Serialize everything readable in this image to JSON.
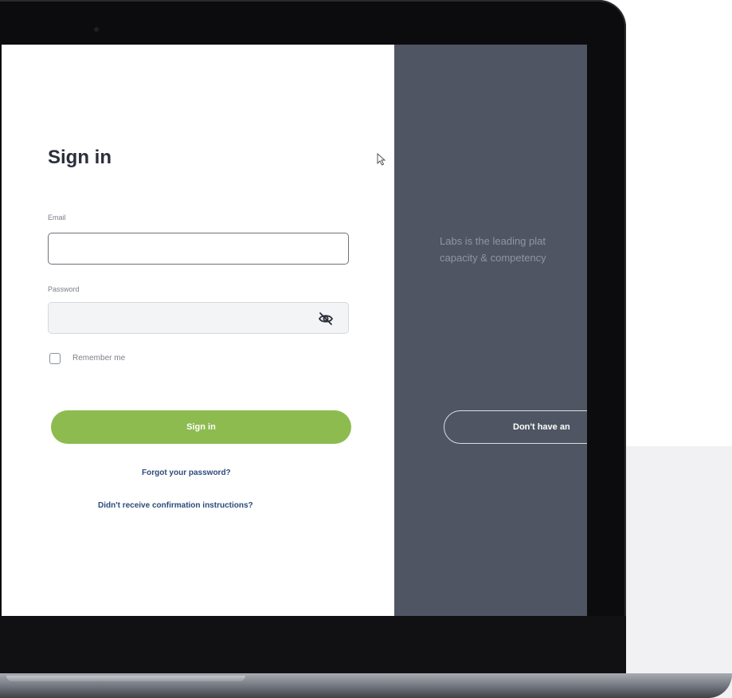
{
  "signin": {
    "title": "Sign in",
    "email_label": "Email",
    "email_value": "",
    "password_label": "Password",
    "password_value": "",
    "password_toggle_icon": "eye-slash-icon",
    "remember_label": "Remember me",
    "remember_checked": false,
    "submit_label": "Sign in",
    "forgot_link": "Forgot your password?",
    "confirm_link": "Didn't receive confirmation instructions?"
  },
  "promo": {
    "tagline_line1": "Labs is the leading plat",
    "tagline_line2": "capacity & competency",
    "signup_button": "Don't have an"
  },
  "colors": {
    "accent_green": "#8dbb4f",
    "panel_dark": "#4f5562",
    "link_blue": "#2d4a7a"
  }
}
